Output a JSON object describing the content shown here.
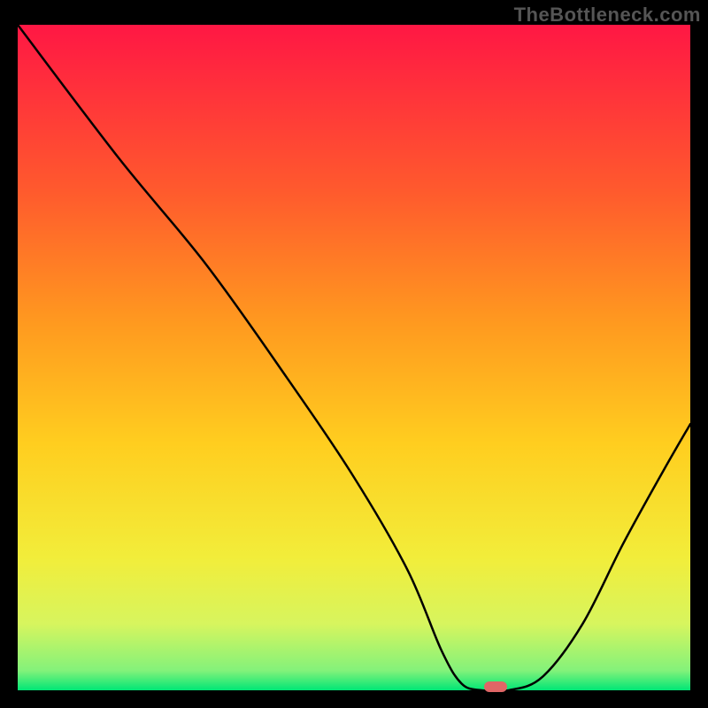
{
  "watermark": "TheBottleneck.com",
  "chart_data": {
    "type": "line",
    "title": "",
    "xlabel": "",
    "ylabel": "",
    "xlim": [
      0,
      100
    ],
    "ylim": [
      0,
      100
    ],
    "x": [
      0,
      15,
      28,
      40,
      50,
      58,
      63,
      66,
      69,
      73,
      78,
      84,
      90,
      96,
      100
    ],
    "values": [
      100,
      80,
      64,
      47,
      32,
      18,
      6,
      1,
      0,
      0,
      2,
      10,
      22,
      33,
      40
    ],
    "gradient_stops": [
      {
        "pct": 0,
        "color": "#ff1744"
      },
      {
        "pct": 25,
        "color": "#ff5a2d"
      },
      {
        "pct": 45,
        "color": "#ff9a1f"
      },
      {
        "pct": 63,
        "color": "#ffce1f"
      },
      {
        "pct": 80,
        "color": "#f2ed3a"
      },
      {
        "pct": 90,
        "color": "#d7f55e"
      },
      {
        "pct": 97,
        "color": "#84f27a"
      },
      {
        "pct": 100,
        "color": "#00e676"
      }
    ],
    "marker": {
      "x": 71,
      "y": 0,
      "color": "#e06666"
    }
  }
}
